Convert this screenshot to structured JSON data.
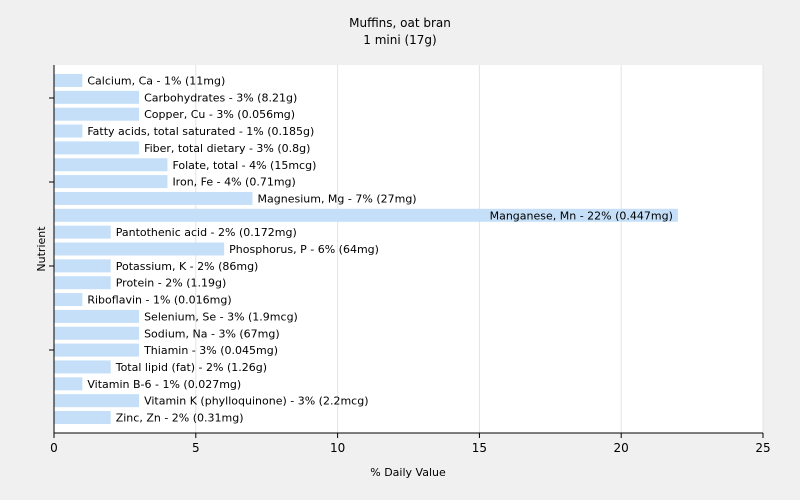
{
  "chart_data": {
    "type": "bar",
    "orientation": "horizontal",
    "title": "Muffins, oat bran",
    "subtitle": "1 mini (17g)",
    "xlabel": "% Daily Value",
    "ylabel": "Nutrient",
    "xlim": [
      0,
      25
    ],
    "xticks": [
      0,
      5,
      10,
      15,
      20,
      25
    ],
    "grid": "vertical",
    "bar_color": "#c5dff8",
    "categories": [
      "Calcium, Ca",
      "Carbohydrates",
      "Copper, Cu",
      "Fatty acids, total saturated",
      "Fiber, total dietary",
      "Folate, total",
      "Iron, Fe",
      "Magnesium, Mg",
      "Manganese, Mn",
      "Pantothenic acid",
      "Phosphorus, P",
      "Potassium, K",
      "Protein",
      "Riboflavin",
      "Selenium, Se",
      "Sodium, Na",
      "Thiamin",
      "Total lipid (fat)",
      "Vitamin B-6",
      "Vitamin K (phylloquinone)",
      "Zinc, Zn"
    ],
    "values": [
      1,
      3,
      3,
      1,
      3,
      4,
      4,
      7,
      22,
      2,
      6,
      2,
      2,
      1,
      3,
      3,
      3,
      2,
      1,
      3,
      2
    ],
    "labels": [
      "Calcium, Ca - 1% (11mg)",
      "Carbohydrates - 3% (8.21g)",
      "Copper, Cu - 3% (0.056mg)",
      "Fatty acids, total saturated - 1% (0.185g)",
      "Fiber, total dietary - 3% (0.8g)",
      "Folate, total - 4% (15mcg)",
      "Iron, Fe - 4% (0.71mg)",
      "Magnesium, Mg - 7% (27mg)",
      "Manganese, Mn - 22% (0.447mg)",
      "Pantothenic acid - 2% (0.172mg)",
      "Phosphorus, P - 6% (64mg)",
      "Potassium, K - 2% (86mg)",
      "Protein - 2% (1.19g)",
      "Riboflavin - 1% (0.016mg)",
      "Selenium, Se - 3% (1.9mcg)",
      "Sodium, Na - 3% (67mg)",
      "Thiamin - 3% (0.045mg)",
      "Total lipid (fat) - 2% (1.26g)",
      "Vitamin B-6 - 1% (0.027mg)",
      "Vitamin K (phylloquinone) - 3% (2.2mcg)",
      "Zinc, Zn - 2% (0.31mg)"
    ]
  }
}
